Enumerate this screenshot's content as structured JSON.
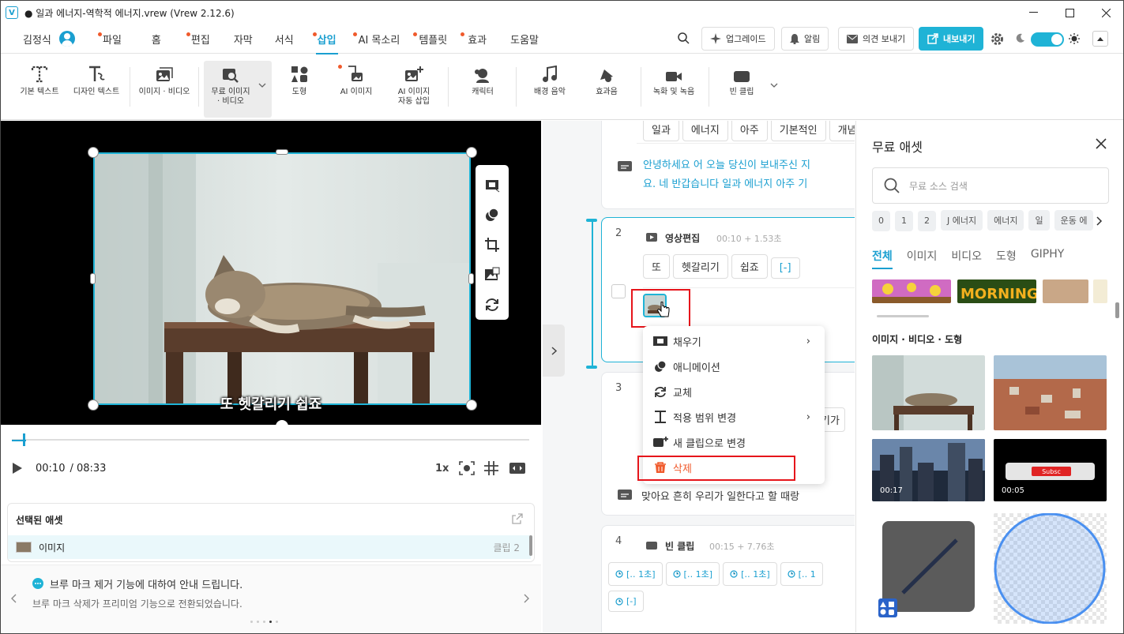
{
  "window": {
    "title": "● 일과 에너지-역학적 에너지.vrew (Vrew 2.12.6)",
    "logo": "V"
  },
  "menubar": {
    "user_name": "김정식",
    "tabs": [
      {
        "label": "파일",
        "dot": true
      },
      {
        "label": "홈",
        "dot": false
      },
      {
        "label": "편집",
        "dot": true
      },
      {
        "label": "자막",
        "dot": false
      },
      {
        "label": "서식",
        "dot": false
      },
      {
        "label": "삽입",
        "dot": true,
        "active": true
      },
      {
        "label": "AI 목소리",
        "dot": true
      },
      {
        "label": "템플릿",
        "dot": true
      },
      {
        "label": "효과",
        "dot": true
      },
      {
        "label": "도움말",
        "dot": false
      }
    ],
    "upgrade": "업그레이드",
    "alarm": "알림",
    "feedback": "의견 보내기",
    "export": "내보내기"
  },
  "toolbar": {
    "items": [
      {
        "label": "기본 텍스트",
        "icon": "text-t-icon"
      },
      {
        "label": "디자인 텍스트",
        "icon": "design-text-icon"
      },
      {
        "label": "이미지 · 비디오",
        "icon": "image-icon"
      },
      {
        "label": "무료 이미지\n· 비디오",
        "icon": "free-image-icon"
      },
      {
        "label": "도형",
        "icon": "shapes-icon"
      },
      {
        "label": "AI 이미지",
        "icon": "ai-image-icon",
        "dot": true
      },
      {
        "label": "AI 이미지\n자동 삽입",
        "icon": "ai-image-auto-icon"
      },
      {
        "label": "캐릭터",
        "icon": "character-icon"
      },
      {
        "label": "배경 음악",
        "icon": "music-note-icon"
      },
      {
        "label": "효과음",
        "icon": "bell-icon"
      },
      {
        "label": "녹화 및 녹음",
        "icon": "video-camera-icon"
      },
      {
        "label": "빈 클립",
        "icon": "blank-clip-icon"
      }
    ]
  },
  "preview": {
    "subtitle": "또 헷갈리기 쉽죠"
  },
  "player": {
    "current": "00:10",
    "total": "/ 08:33",
    "speed": "1x"
  },
  "selected_assets": {
    "title": "선택된 애셋",
    "item_label": "이미지",
    "item_clip": "클립 2"
  },
  "notice": {
    "title": "브루 마크 제거 기능에 대하여 안내 드립니다.",
    "body": "브루 마크 삭제가 프리미엄 기능으로 전환되었습니다."
  },
  "script": {
    "clip1": {
      "words": [
        "일과",
        "에너지",
        "아주",
        "기본적인",
        "개념"
      ],
      "text_line1": "안녕하세요 어 오늘 당신이 보내주신 지",
      "text_line2": "요. 네 반갑습니다 일과 에너지 아주 기"
    },
    "clip2": {
      "number": "2",
      "title": "영상편집",
      "time": "00:10 + 1.53초",
      "words": [
        "또",
        "헷갈리기",
        "쉽죠",
        "[-]"
      ]
    },
    "clip3": {
      "number": "3",
      "word_partial": "기가",
      "text": "맞아요 흔히 우리가 일한다고 할 때랑"
    },
    "clip4": {
      "number": "4",
      "title": "빈 클립",
      "time": "00:15 + 7.76초",
      "pills": [
        "[‥ 1초]",
        "[‥ 1초]",
        "[‥ 1초]",
        "[‥ 1",
        "[-]"
      ]
    }
  },
  "context_menu": {
    "items": [
      "채우기",
      "애니메이션",
      "교체",
      "적용 범위 변경",
      "새 클립으로 변경",
      "삭제"
    ]
  },
  "asset_panel": {
    "title": "무료 애셋",
    "search_placeholder": "무료 소스 검색",
    "chips": [
      "0",
      "1",
      "2",
      "J 에너지",
      "에너지",
      "일",
      "운동 에"
    ],
    "filter_tabs": [
      "전체",
      "이미지",
      "비디오",
      "도형",
      "GIPHY"
    ],
    "section_title": "이미지 · 비디오 · 도형",
    "durations": [
      "00:17",
      "00:05"
    ],
    "subscribe_text": "Subsc"
  }
}
